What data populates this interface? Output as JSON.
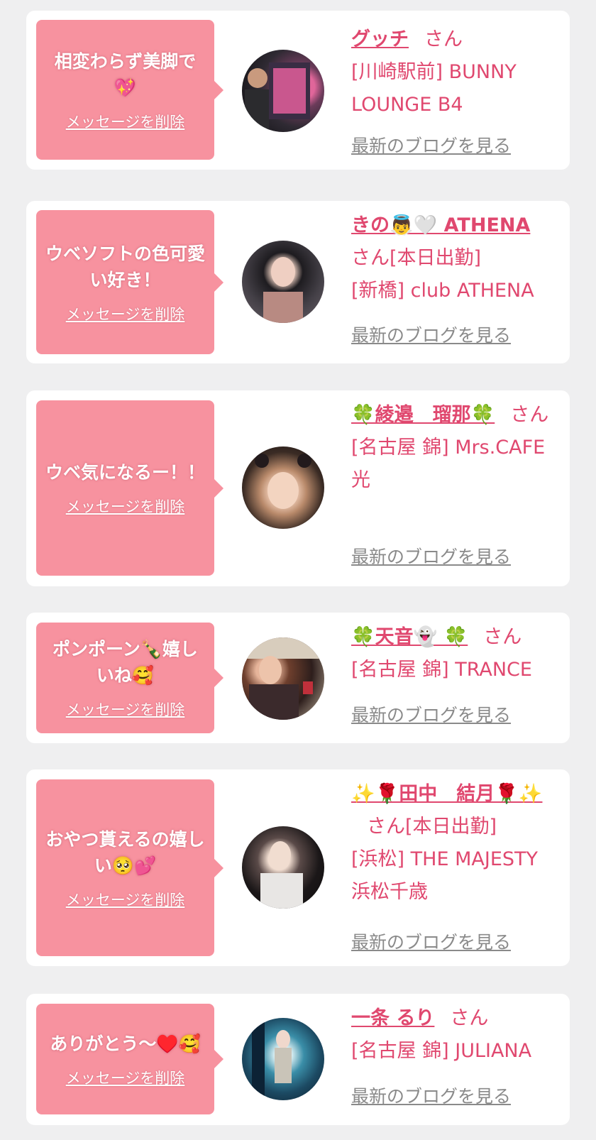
{
  "delete_label": "メッセージを削除",
  "honorific": "さん",
  "blog_label": "最新のブログを見る",
  "colors": {
    "bubble": "#f7929f",
    "name": "#e0486f",
    "page_bg": "#efeff0",
    "link_gray": "#8a8a8a"
  },
  "cards": [
    {
      "message": "相変わらず美脚で💖",
      "name": "グッチ",
      "status": "",
      "shop": "[川崎駅前] BUNNY LOUNGE B4"
    },
    {
      "message": "ウベソフトの色可愛い好き！",
      "name": "きの👼🤍 ATHENA",
      "status": "[本日出勤]",
      "shop": "[新橋] club ATHENA"
    },
    {
      "message": "ウベ気になるー！！",
      "name": "🍀綾邉　瑠那🍀",
      "status": "",
      "shop": "[名古屋 錦] Mrs.CAFE 光"
    },
    {
      "message": "ポンポーン🍾嬉しいね🥰",
      "name": "🍀天音👻 🍀",
      "status": "",
      "shop": "[名古屋 錦] TRANCE"
    },
    {
      "message": "おやつ貰えるの嬉しい🥺💕",
      "name": "✨🌹田中　結月🌹✨",
      "status": "[本日出勤]",
      "shop": "[浜松] THE MAJESTY 浜松千歳"
    },
    {
      "message": "ありがとう〜♥️🥰",
      "name": "一条 るり",
      "status": "",
      "shop": "[名古屋 錦] JULIANA"
    }
  ]
}
